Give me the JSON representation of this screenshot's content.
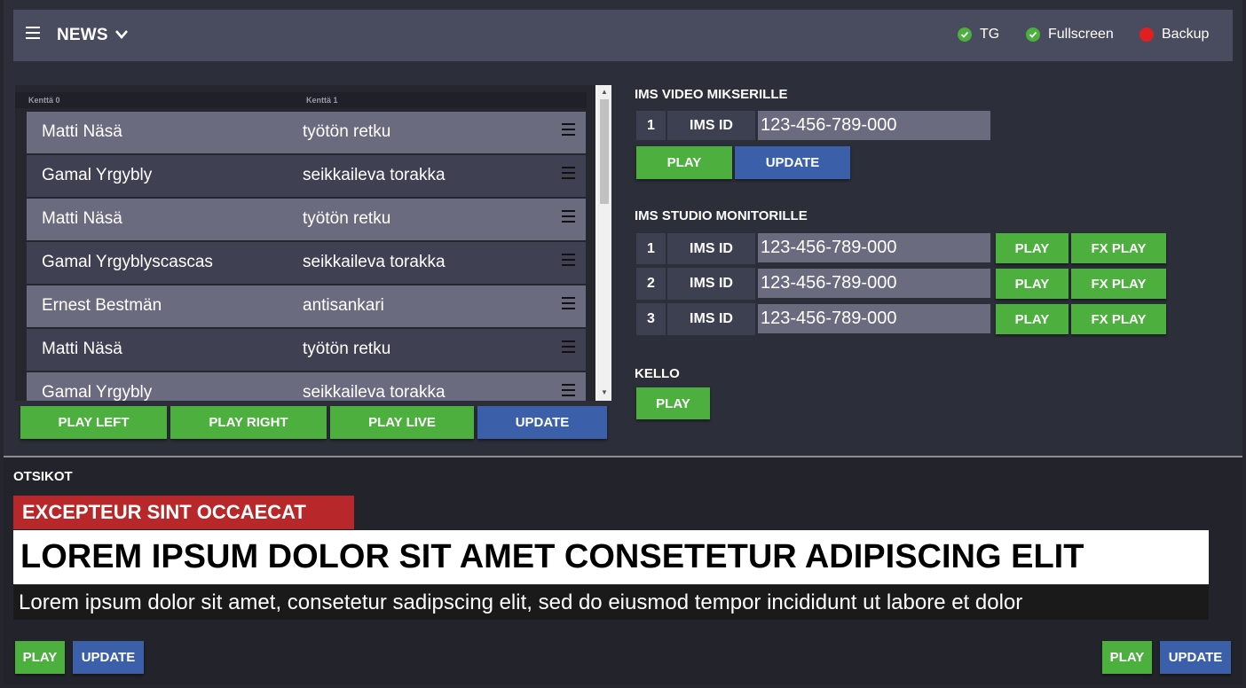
{
  "header": {
    "title": "NEWS",
    "status": [
      {
        "label": "TG",
        "state": "ok",
        "color": "#4caf3e"
      },
      {
        "label": "Fullscreen",
        "state": "ok",
        "color": "#4caf3e"
      },
      {
        "label": "Backup",
        "state": "error",
        "color": "#e02020"
      }
    ]
  },
  "list": {
    "columns": [
      "Kenttä 0",
      "Kenttä 1"
    ],
    "rows": [
      {
        "name": "Matti Näsä",
        "role": "työtön retku"
      },
      {
        "name": "Gamal Yrgybly",
        "role": "seikkaileva torakka"
      },
      {
        "name": "Matti Näsä",
        "role": "työtön retku"
      },
      {
        "name": "Gamal Yrgyblyscascas",
        "role": "seikkaileva torakka"
      },
      {
        "name": "Ernest Bestmän",
        "role": "antisankari"
      },
      {
        "name": "Matti Näsä",
        "role": "työtön retku"
      },
      {
        "name": "Gamal Yrgybly",
        "role": "seikkaileva torakka"
      }
    ],
    "buttons": {
      "play_left": "PLAY LEFT",
      "play_right": "PLAY RIGHT",
      "play_live": "PLAY LIVE",
      "update": "UPDATE"
    }
  },
  "ims_video": {
    "title": "IMS VIDEO MIKSERILLE",
    "rows": [
      {
        "index": "1",
        "label": "IMS ID",
        "value": "123-456-789-000"
      }
    ],
    "play": "PLAY",
    "update": "UPDATE"
  },
  "ims_studio": {
    "title": "IMS STUDIO MONITORILLE",
    "rows": [
      {
        "index": "1",
        "label": "IMS ID",
        "value": "123-456-789-000",
        "play": "PLAY",
        "fx_play": "FX PLAY"
      },
      {
        "index": "2",
        "label": "IMS ID",
        "value": "123-456-789-000",
        "play": "PLAY",
        "fx_play": "FX PLAY"
      },
      {
        "index": "3",
        "label": "IMS ID",
        "value": "123-456-789-000",
        "play": "PLAY",
        "fx_play": "FX PLAY"
      }
    ]
  },
  "kello": {
    "title": "KELLO",
    "play": "PLAY"
  },
  "otsikot": {
    "title": "OTSIKOT",
    "kicker": "EXCEPTEUR SINT OCCAECAT",
    "headline": "LOREM IPSUM DOLOR SIT AMET CONSETETUR ADIPISCING ELIT",
    "subline": "Lorem ipsum dolor sit amet, consetetur sadipscing elit, sed do eiusmod tempor incididunt ut labore et dolor",
    "left_play": "PLAY",
    "left_update": "UPDATE",
    "right_play": "PLAY",
    "right_update": "UPDATE"
  },
  "colors": {
    "green": "#4caf3e",
    "blue": "#3b5fa9",
    "red": "#b8282a"
  }
}
